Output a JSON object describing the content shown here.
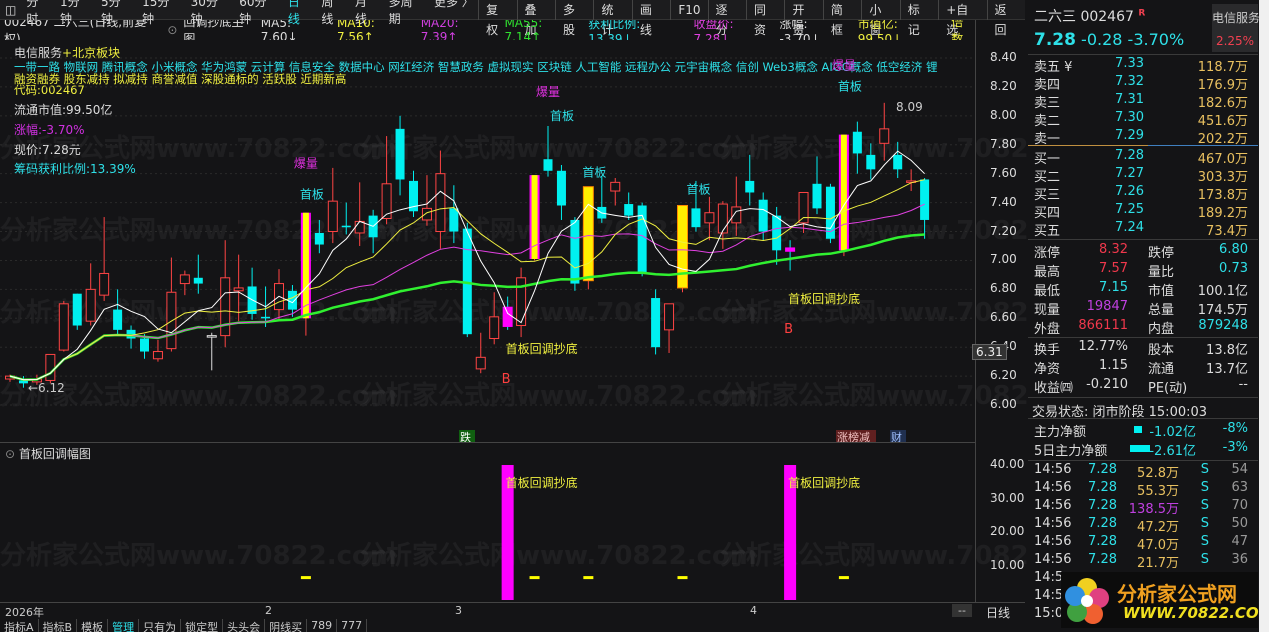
{
  "toolbar": {
    "left": [
      "分时",
      "1分钟",
      "5分钟",
      "15分钟",
      "30分钟",
      "60分钟",
      "日线",
      "周线",
      "月线",
      "多周期",
      "更多 〉"
    ],
    "active": "日线",
    "right": [
      "复权",
      "叠加",
      "多股",
      "统计",
      "画线",
      "F10",
      "逐分",
      "同资",
      "开资",
      "简框",
      "小窗",
      "标记",
      "+自选",
      "返回"
    ]
  },
  "info": {
    "title": "002467 二六三(日线,前复权)",
    "formula": "回调抄底主图",
    "ma5": "MA5: 7.60↓",
    "ma10": "MA10: 7.56↑",
    "ma20": "MA20: 7.39↑",
    "ma55": "MA55: 7.14↑",
    "profit": "获利比例: 13.39↓",
    "close": "收盘价: 7.28↓",
    "change": "涨幅: -3.70↓",
    "mktcap": "市值亿: 99.50↓",
    "multiple": "倍数"
  },
  "overlay": {
    "sector": "电信服务",
    "region": "+北京板块",
    "concepts": "一带一路 物联网 腾讯概念 小米概念 华为鸿蒙 云计算 信息安全 数据中心 网红经济 智慧政务 虚拟现实 区块链 人工智能 远程办公 元宇宙概念 信创 Web3概念 AIGC概念 低空经济 锂",
    "tags": "融资融券 股东减持 拟减持 商誉减值 深股通标的 活跃股 近期新高",
    "code": "代码:002467",
    "float_cap": "流通市值:99.50亿",
    "change": "涨幅:-3.70%",
    "price": "现价:7.28元",
    "chip": "筹码获利比例:13.39%"
  },
  "annotations": {
    "burst": "爆量",
    "first": "首板",
    "dip": "首板回调抄底",
    "buy": "B",
    "low": "←6.12",
    "high": "8.09",
    "down": "跌",
    "zb": "涨榜减",
    "cai": "财"
  },
  "axis": {
    "price_ticks": [
      "8.40",
      "8.20",
      "8.00",
      "7.80",
      "7.60",
      "7.40",
      "7.20",
      "7.00",
      "6.80",
      "6.60",
      "6.40",
      "6.20",
      "6.00"
    ],
    "current": "6.31",
    "lower_ticks": [
      "40.00",
      "30.00",
      "20.00",
      "10.00"
    ],
    "dates": [
      "2026年",
      "2",
      "3",
      "4"
    ],
    "period": "日线",
    "dash": "--"
  },
  "lower_panel": {
    "title": "首板回调幅图",
    "label": "首板回调抄底"
  },
  "bottom_tabs": [
    "指标A",
    "指标B",
    "模板",
    "管理",
    "只有为",
    "锁定型",
    "头头会",
    "阴线买",
    "789",
    "777"
  ],
  "watermark": "分析家公式网www.70822.com",
  "logo": {
    "name": "分析家公式网",
    "url": "WWW.70822.COM"
  },
  "right_panel": {
    "name": "二六三",
    "code": "002467",
    "r": "R",
    "sector": "电信服务",
    "sector_pct": "2.25%",
    "price": "7.28",
    "chg": "-0.28",
    "pct": "-3.70%",
    "asks": [
      [
        "卖五 ¥",
        "7.33",
        "118.7万"
      ],
      [
        "卖四",
        "7.32",
        "176.9万"
      ],
      [
        "卖三",
        "7.31",
        "182.6万"
      ],
      [
        "卖二",
        "7.30",
        "451.6万"
      ],
      [
        "卖一",
        "7.29",
        "202.2万"
      ]
    ],
    "bids": [
      [
        "买一",
        "7.28",
        "467.0万"
      ],
      [
        "买二",
        "7.27",
        "303.3万"
      ],
      [
        "买三",
        "7.26",
        "173.8万"
      ],
      [
        "买四",
        "7.25",
        "189.2万"
      ],
      [
        "买五",
        "7.24",
        "73.4万"
      ]
    ],
    "stats": [
      [
        "涨停",
        "8.32",
        "跌停",
        "6.80"
      ],
      [
        "最高",
        "7.57",
        "量比",
        "0.73"
      ],
      [
        "最低",
        "7.15",
        "市值",
        "100.1亿"
      ],
      [
        "现量",
        "19847",
        "总量",
        "174.5万"
      ],
      [
        "外盘",
        "866111",
        "内盘",
        "879248"
      ]
    ],
    "stats2": [
      [
        "换手",
        "12.77%",
        "股本",
        "13.8亿"
      ],
      [
        "净资",
        "1.15",
        "流通",
        "13.7亿"
      ],
      [
        "收益㈣",
        "-0.210",
        "PE(动)",
        "--"
      ]
    ],
    "status": "交易状态: 闭市阶段 15:00:03",
    "flow": [
      [
        "主力净额",
        "-1.02亿",
        "-8%"
      ],
      [
        "5日主力净额",
        "-2.61亿",
        "-3%"
      ]
    ],
    "ticks": [
      [
        "14:56",
        "7.28",
        "52.8万",
        "S",
        "54"
      ],
      [
        "14:56",
        "7.28",
        "55.3万",
        "S",
        "63"
      ],
      [
        "14:56",
        "7.28",
        "138.5万",
        "S",
        "70"
      ],
      [
        "14:56",
        "7.28",
        "47.2万",
        "S",
        "50"
      ],
      [
        "14:56",
        "7.28",
        "47.0万",
        "S",
        "47"
      ],
      [
        "14:56",
        "7.28",
        "21.7万",
        "S",
        "36"
      ],
      [
        "14:5"
      ],
      [
        "14:5"
      ],
      [
        "15:0"
      ]
    ]
  },
  "colors": {
    "up": "#ff4444",
    "down": "#00f0f0",
    "ma5": "#ffffff",
    "ma10": "#f0f040",
    "ma20": "#e040e0",
    "ma55": "#30f030"
  },
  "chart_data": {
    "type": "candlestick",
    "title": "二六三(日线,前复权) 回调抄底主图",
    "ylim": [
      6.0,
      8.4
    ],
    "candles": [
      [
        6.18,
        6.21,
        6.16,
        6.2
      ],
      [
        6.17,
        6.2,
        6.12,
        6.15
      ],
      [
        6.16,
        6.21,
        6.14,
        6.18
      ],
      [
        6.17,
        6.35,
        6.15,
        6.35
      ],
      [
        6.38,
        6.72,
        6.37,
        6.7
      ],
      [
        6.77,
        6.77,
        6.52,
        6.55
      ],
      [
        6.58,
        6.98,
        6.55,
        6.8
      ],
      [
        6.76,
        7.3,
        6.72,
        6.91
      ],
      [
        6.66,
        6.8,
        6.49,
        6.52
      ],
      [
        6.52,
        6.55,
        6.39,
        6.46
      ],
      [
        6.46,
        6.49,
        6.32,
        6.37
      ],
      [
        6.32,
        6.45,
        6.3,
        6.37
      ],
      [
        6.39,
        7.02,
        6.37,
        6.78
      ],
      [
        6.84,
        6.93,
        6.76,
        6.9
      ],
      [
        6.88,
        7.04,
        6.77,
        6.84
      ],
      [
        6.48,
        6.5,
        6.24,
        6.48,
        "w"
      ],
      [
        6.48,
        7.14,
        6.4,
        6.88
      ],
      [
        6.79,
        7.04,
        6.58,
        6.81
      ],
      [
        6.82,
        6.95,
        6.59,
        6.63
      ],
      [
        6.61,
        6.82,
        6.54,
        6.6
      ],
      [
        6.66,
        6.94,
        6.58,
        6.84
      ],
      [
        6.79,
        6.83,
        6.61,
        6.66
      ],
      [
        6.6,
        7.33,
        6.48,
        7.33,
        "ym"
      ],
      [
        7.19,
        7.28,
        7.05,
        7.11
      ],
      [
        7.2,
        7.64,
        7.12,
        7.41
      ],
      [
        7.24,
        7.4,
        7.18,
        7.23
      ],
      [
        7.19,
        7.54,
        7.1,
        7.27
      ],
      [
        7.31,
        7.35,
        7.05,
        7.16
      ],
      [
        7.29,
        7.86,
        7.25,
        7.53
      ],
      [
        7.91,
        8.0,
        7.45,
        7.56
      ],
      [
        7.55,
        7.62,
        7.3,
        7.34
      ],
      [
        7.28,
        7.59,
        7.24,
        7.36
      ],
      [
        7.2,
        7.76,
        7.08,
        7.6
      ],
      [
        7.36,
        7.52,
        7.12,
        7.2
      ],
      [
        7.22,
        7.26,
        6.47,
        6.49
      ],
      [
        6.25,
        6.5,
        6.22,
        6.33
      ],
      [
        6.46,
        6.78,
        6.42,
        6.61
      ],
      [
        6.68,
        6.75,
        6.52,
        6.54,
        "m"
      ],
      [
        6.55,
        6.95,
        6.47,
        6.88
      ],
      [
        7.01,
        7.59,
        7.0,
        7.59,
        "ym"
      ],
      [
        7.7,
        7.93,
        7.58,
        7.62
      ],
      [
        7.62,
        7.66,
        7.28,
        7.38
      ],
      [
        7.28,
        7.3,
        6.79,
        6.84
      ],
      [
        6.86,
        7.51,
        6.8,
        7.51,
        "y"
      ],
      [
        7.37,
        7.58,
        7.26,
        7.29
      ],
      [
        7.48,
        7.57,
        7.38,
        7.54
      ],
      [
        7.39,
        7.47,
        7.28,
        7.31
      ],
      [
        7.38,
        7.4,
        6.89,
        6.91
      ],
      [
        6.74,
        6.8,
        6.35,
        6.4
      ],
      [
        6.52,
        6.7,
        6.36,
        6.7
      ],
      [
        6.81,
        7.38,
        6.78,
        7.38,
        "y"
      ],
      [
        7.36,
        7.55,
        7.2,
        7.23
      ],
      [
        7.26,
        7.44,
        7.14,
        7.33
      ],
      [
        7.19,
        7.41,
        7.08,
        7.39
      ],
      [
        7.26,
        7.58,
        7.17,
        7.37
      ],
      [
        7.55,
        7.73,
        7.38,
        7.47
      ],
      [
        7.42,
        7.47,
        7.14,
        7.2
      ],
      [
        7.31,
        7.37,
        6.97,
        7.07
      ],
      [
        7.09,
        7.14,
        6.93,
        7.06,
        "m"
      ],
      [
        7.26,
        7.47,
        7.19,
        7.47
      ],
      [
        7.53,
        7.72,
        7.32,
        7.36
      ],
      [
        7.51,
        7.53,
        7.12,
        7.15
      ],
      [
        7.07,
        7.87,
        7.03,
        7.87,
        "ym"
      ],
      [
        7.89,
        7.96,
        7.6,
        7.74
      ],
      [
        7.73,
        7.81,
        7.56,
        7.63
      ],
      [
        7.81,
        8.09,
        7.69,
        7.91
      ],
      [
        7.73,
        7.82,
        7.57,
        7.63
      ],
      [
        7.55,
        7.63,
        7.48,
        7.55,
        "x"
      ],
      [
        7.56,
        7.57,
        7.15,
        7.28
      ]
    ],
    "burst_idx": [
      22,
      40,
      62
    ],
    "first_idx": [
      22,
      40,
      43,
      50,
      62
    ],
    "dip_idx": [
      37,
      58
    ],
    "lower": {
      "type": "bar",
      "bars": [
        {
          "i": 37,
          "v": 40
        },
        {
          "i": 58,
          "v": 40
        }
      ],
      "marks": [
        {
          "i": 22,
          "v": 7
        },
        {
          "i": 39,
          "v": 7
        },
        {
          "i": 43,
          "v": 7
        },
        {
          "i": 50,
          "v": 7
        },
        {
          "i": 62,
          "v": 7
        }
      ],
      "ylim": [
        0,
        40
      ]
    }
  }
}
